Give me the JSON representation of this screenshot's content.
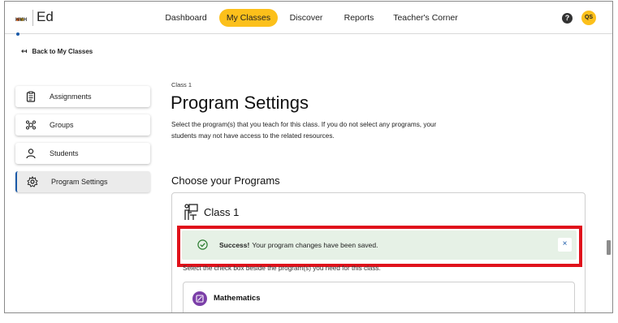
{
  "app": {
    "brand_small": "HMH",
    "brand_name": "Ed"
  },
  "nav": {
    "items": [
      {
        "label": "Dashboard",
        "active": false
      },
      {
        "label": "My Classes",
        "active": true
      },
      {
        "label": "Discover",
        "active": false
      },
      {
        "label": "Reports",
        "active": false
      },
      {
        "label": "Teacher's Corner",
        "active": false
      }
    ],
    "help_icon": "question-circle-icon",
    "avatar_initials": "QS"
  },
  "back_link": {
    "label": "Back to My Classes",
    "icon": "arrow-left-icon"
  },
  "sidebar": {
    "items": [
      {
        "label": "Assignments",
        "icon": "clipboard-icon",
        "active": false
      },
      {
        "label": "Groups",
        "icon": "groups-icon",
        "active": false
      },
      {
        "label": "Students",
        "icon": "person-icon",
        "active": false
      },
      {
        "label": "Program Settings",
        "icon": "gear-icon",
        "active": true
      }
    ]
  },
  "main": {
    "breadcrumb": "Class 1",
    "title": "Program Settings",
    "description": "Select the program(s) that you teach for this class. If you do not select any programs, your students may not have access to the related resources.",
    "section_title": "Choose your Programs",
    "card": {
      "title": "Class 1",
      "icon": "classroom-icon",
      "toast": {
        "title": "Success!",
        "message": "Your program changes have been saved.",
        "close_label": "×"
      },
      "instructions": "Select the check box beside the program(s) you need for this class.",
      "program": {
        "label": "Mathematics",
        "icon": "math-icon"
      }
    }
  },
  "colors": {
    "accent": "#fcc01b",
    "highlight": "#e0111b",
    "success_bg": "#e6f1e6",
    "success_icon": "#2e7d32",
    "link": "#1a5aa8",
    "program_icon": "#7b3fa8"
  }
}
